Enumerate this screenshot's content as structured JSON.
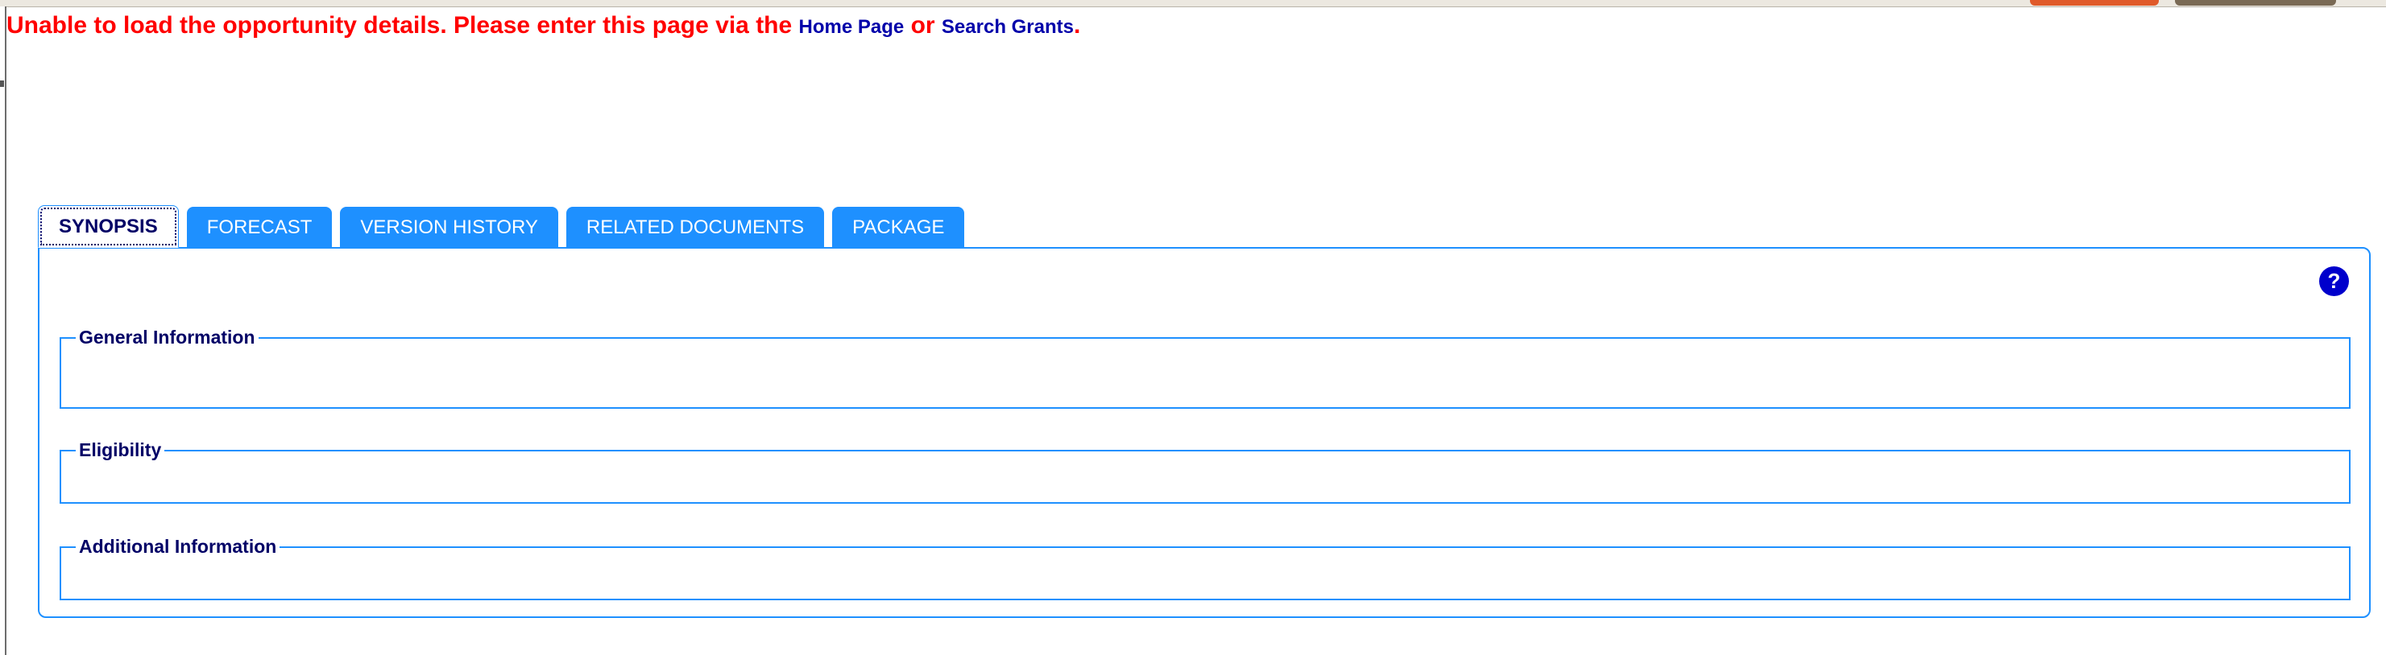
{
  "error": {
    "message_before": "Unable to load the opportunity details. Please enter this page via the ",
    "home_link": "Home Page",
    "middle": " or ",
    "search_link": "Search Grants",
    "end": "."
  },
  "tabs": [
    {
      "label": "SYNOPSIS",
      "active": true
    },
    {
      "label": "FORECAST",
      "active": false
    },
    {
      "label": "VERSION HISTORY",
      "active": false
    },
    {
      "label": "RELATED DOCUMENTS",
      "active": false
    },
    {
      "label": "PACKAGE",
      "active": false
    }
  ],
  "panel": {
    "help_label": "?",
    "sections": [
      {
        "legend": "General Information"
      },
      {
        "legend": "Eligibility"
      },
      {
        "legend": "Additional Information"
      }
    ]
  },
  "colors": {
    "error_text": "#ff0000",
    "link": "#0000aa",
    "tab_blue": "#1e90ff",
    "legend_navy": "#000066"
  },
  "icons": {
    "help": "question-mark-circle-icon"
  }
}
